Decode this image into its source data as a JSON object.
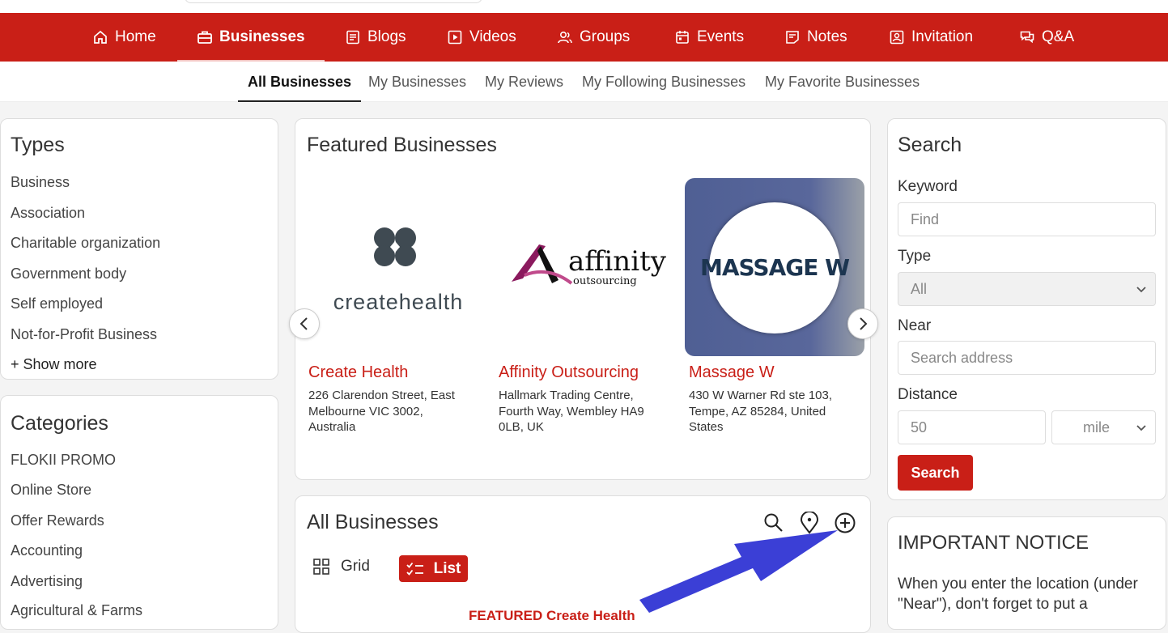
{
  "nav": {
    "items": [
      {
        "label": "Home",
        "icon": "home-icon"
      },
      {
        "label": "Businesses",
        "icon": "briefcase-icon",
        "active": true
      },
      {
        "label": "Blogs",
        "icon": "blog-icon"
      },
      {
        "label": "Videos",
        "icon": "video-icon"
      },
      {
        "label": "Groups",
        "icon": "groups-icon"
      },
      {
        "label": "Events",
        "icon": "calendar-icon"
      },
      {
        "label": "Notes",
        "icon": "notes-icon"
      },
      {
        "label": "Invitation",
        "icon": "invitation-icon"
      },
      {
        "label": "Q&A",
        "icon": "qa-icon"
      }
    ]
  },
  "subnav": {
    "items": [
      "All Businesses",
      "My Businesses",
      "My Reviews",
      "My Following Businesses",
      "My Favorite Businesses"
    ]
  },
  "types": {
    "title": "Types",
    "items": [
      "Business",
      "Association",
      "Charitable organization",
      "Government body",
      "Self employed",
      "Not-for-Profit Business"
    ],
    "show_more": "+ Show more"
  },
  "categories": {
    "title": "Categories",
    "items": [
      "FLOKII PROMO",
      "Online Store",
      "Offer Rewards",
      "Accounting",
      "Advertising",
      "Agricultural & Farms"
    ]
  },
  "featured": {
    "title": "Featured Businesses",
    "items": [
      {
        "name": "Create Health",
        "logo_text": "createhealth",
        "address": "226 Clarendon Street, East Melbourne VIC 3002, Australia"
      },
      {
        "name": "Affinity Outsourcing",
        "logo_text": "affinity",
        "logo_subtext": "outsourcing",
        "address": "Hallmark Trading Centre, Fourth Way, Wembley HA9 0LB, UK"
      },
      {
        "name": "Massage W",
        "logo_text": "MASSAGE W",
        "address": "430 W Warner Rd ste 103, Tempe, AZ 85284, United States"
      }
    ]
  },
  "all_businesses": {
    "title": "All Businesses",
    "view_grid": "Grid",
    "view_list": "List",
    "first_item_preview": "FEATURED Create Health"
  },
  "search": {
    "title": "Search",
    "keyword_label": "Keyword",
    "keyword_placeholder": "Find",
    "type_label": "Type",
    "type_value": "All",
    "near_label": "Near",
    "near_placeholder": "Search address",
    "distance_label": "Distance",
    "distance_placeholder": "50",
    "unit_value": "mile",
    "button": "Search"
  },
  "notice": {
    "title": "IMPORTANT NOTICE",
    "text_line1": "When you enter the location (under",
    "text_line2": "\"Near\"), don't forget to put a"
  },
  "colors": {
    "brand": "#c91f17",
    "annotation_arrow": "#3b3fd6"
  }
}
